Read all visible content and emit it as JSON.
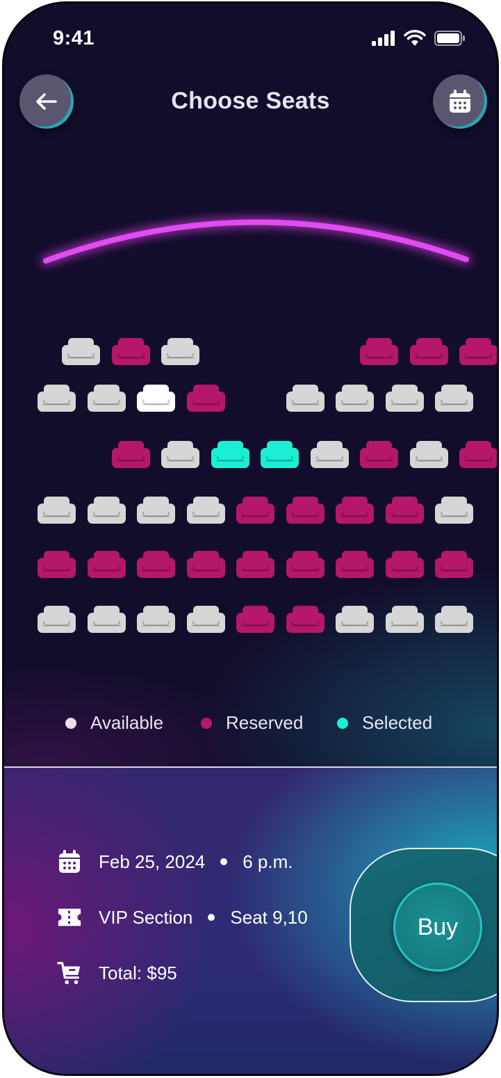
{
  "status_bar": {
    "time": "9:41"
  },
  "header": {
    "title": "Choose Seats",
    "back_icon": "arrow-left-icon",
    "calendar_icon": "calendar-icon"
  },
  "colors": {
    "available": "#d6d6d6",
    "reserved": "#b5176a",
    "selected": "#19f0d3",
    "highlighted": "#ffffff",
    "screen": "#e04cf0"
  },
  "seat_rows": [
    [
      "available",
      "reserved",
      "available",
      null,
      null,
      null,
      "reserved",
      "reserved",
      "reserved"
    ],
    [
      "available",
      "available",
      "highlighted",
      "reserved",
      null,
      "available",
      "available",
      "available",
      "available"
    ],
    [
      null,
      "reserved",
      "available",
      "selected",
      "selected",
      "available",
      "reserved",
      "available",
      "reserved"
    ],
    [
      "available",
      "available",
      "available",
      "available",
      "reserved",
      "reserved",
      "reserved",
      "reserved",
      "available"
    ],
    [
      "reserved",
      "reserved",
      "reserved",
      "reserved",
      "reserved",
      "reserved",
      "reserved",
      "reserved",
      "reserved"
    ],
    [
      "available",
      "available",
      "available",
      "available",
      "reserved",
      "reserved",
      "available",
      "available",
      "available"
    ]
  ],
  "legend": [
    {
      "label": "Available",
      "color": "#efdde8"
    },
    {
      "label": "Reserved",
      "color": "#b5176a"
    },
    {
      "label": "Selected",
      "color": "#19f0d3"
    }
  ],
  "booking": {
    "date": "Feb 25, 2024",
    "time": "6 p.m.",
    "section": "VIP Section",
    "seat": "Seat 9,10",
    "total": "Total: $95"
  },
  "buy_label": "Buy"
}
